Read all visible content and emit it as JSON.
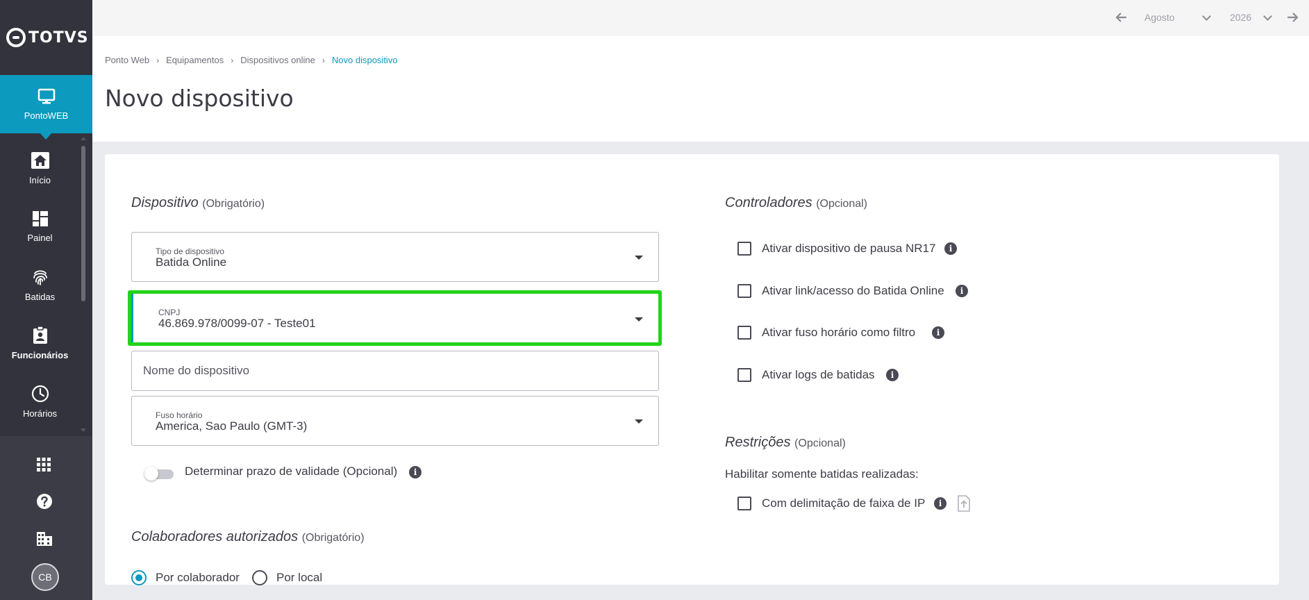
{
  "brand": {
    "name": "TOTVS"
  },
  "sidebar": {
    "active": {
      "label": "PontoWEB",
      "icon": "monitor-icon"
    },
    "items": [
      {
        "label": "Início",
        "icon": "home-icon"
      },
      {
        "label": "Painel",
        "icon": "dashboard-icon"
      },
      {
        "label": "Batidas",
        "icon": "fingerprint-icon"
      },
      {
        "label": "Funcionários",
        "icon": "id-badge-icon"
      },
      {
        "label": "Horários",
        "icon": "clock-icon"
      }
    ],
    "bottom": {
      "apps_icon": "grid-icon",
      "help_icon": "help-icon",
      "company_icon": "building-icon",
      "avatar_initials": "CB"
    }
  },
  "topbar": {
    "month": "Agosto",
    "year": "2026",
    "prev_icon": "arrow-left-icon",
    "next_icon": "arrow-right-icon"
  },
  "breadcrumb": {
    "items": [
      "Ponto Web",
      "Equipamentos",
      "Dispositivos online"
    ],
    "current": "Novo dispositivo",
    "separator": "›"
  },
  "page": {
    "title": "Novo dispositivo"
  },
  "dispositivo": {
    "title": "Dispositivo",
    "subtitle": "(Obrigatório)",
    "tipo": {
      "label": "Tipo de dispositivo",
      "value": "Batida Online"
    },
    "cnpj": {
      "label": "CNPJ",
      "value": "46.869.978/0099-07 - Teste01"
    },
    "nome": {
      "placeholder": "Nome do dispositivo"
    },
    "fuso": {
      "label": "Fuso horário",
      "value": "America, Sao Paulo (GMT-3)"
    },
    "validade": {
      "label": "Determinar prazo de validade (Opcional)",
      "enabled": false
    }
  },
  "controladores": {
    "title": "Controladores",
    "subtitle": "(Opcional)",
    "options": [
      {
        "label": "Ativar dispositivo de pausa NR17",
        "checked": false
      },
      {
        "label": "Ativar link/acesso do Batida Online",
        "checked": false
      },
      {
        "label": "Ativar fuso horário como filtro",
        "checked": false
      },
      {
        "label": "Ativar logs de batidas",
        "checked": false
      }
    ]
  },
  "restricoes": {
    "title": "Restrições",
    "subtitle": "(Opcional)",
    "text": "Habilitar somente batidas realizadas:",
    "option": {
      "label": "Com delimitação de faixa de IP",
      "checked": false
    },
    "upload_icon": "file-upload-icon"
  },
  "colaboradores": {
    "title": "Colaboradores autorizados",
    "subtitle": "(Obrigatório)",
    "options": [
      {
        "label": "Por colaborador",
        "checked": true
      },
      {
        "label": "Por local",
        "checked": false
      }
    ]
  }
}
